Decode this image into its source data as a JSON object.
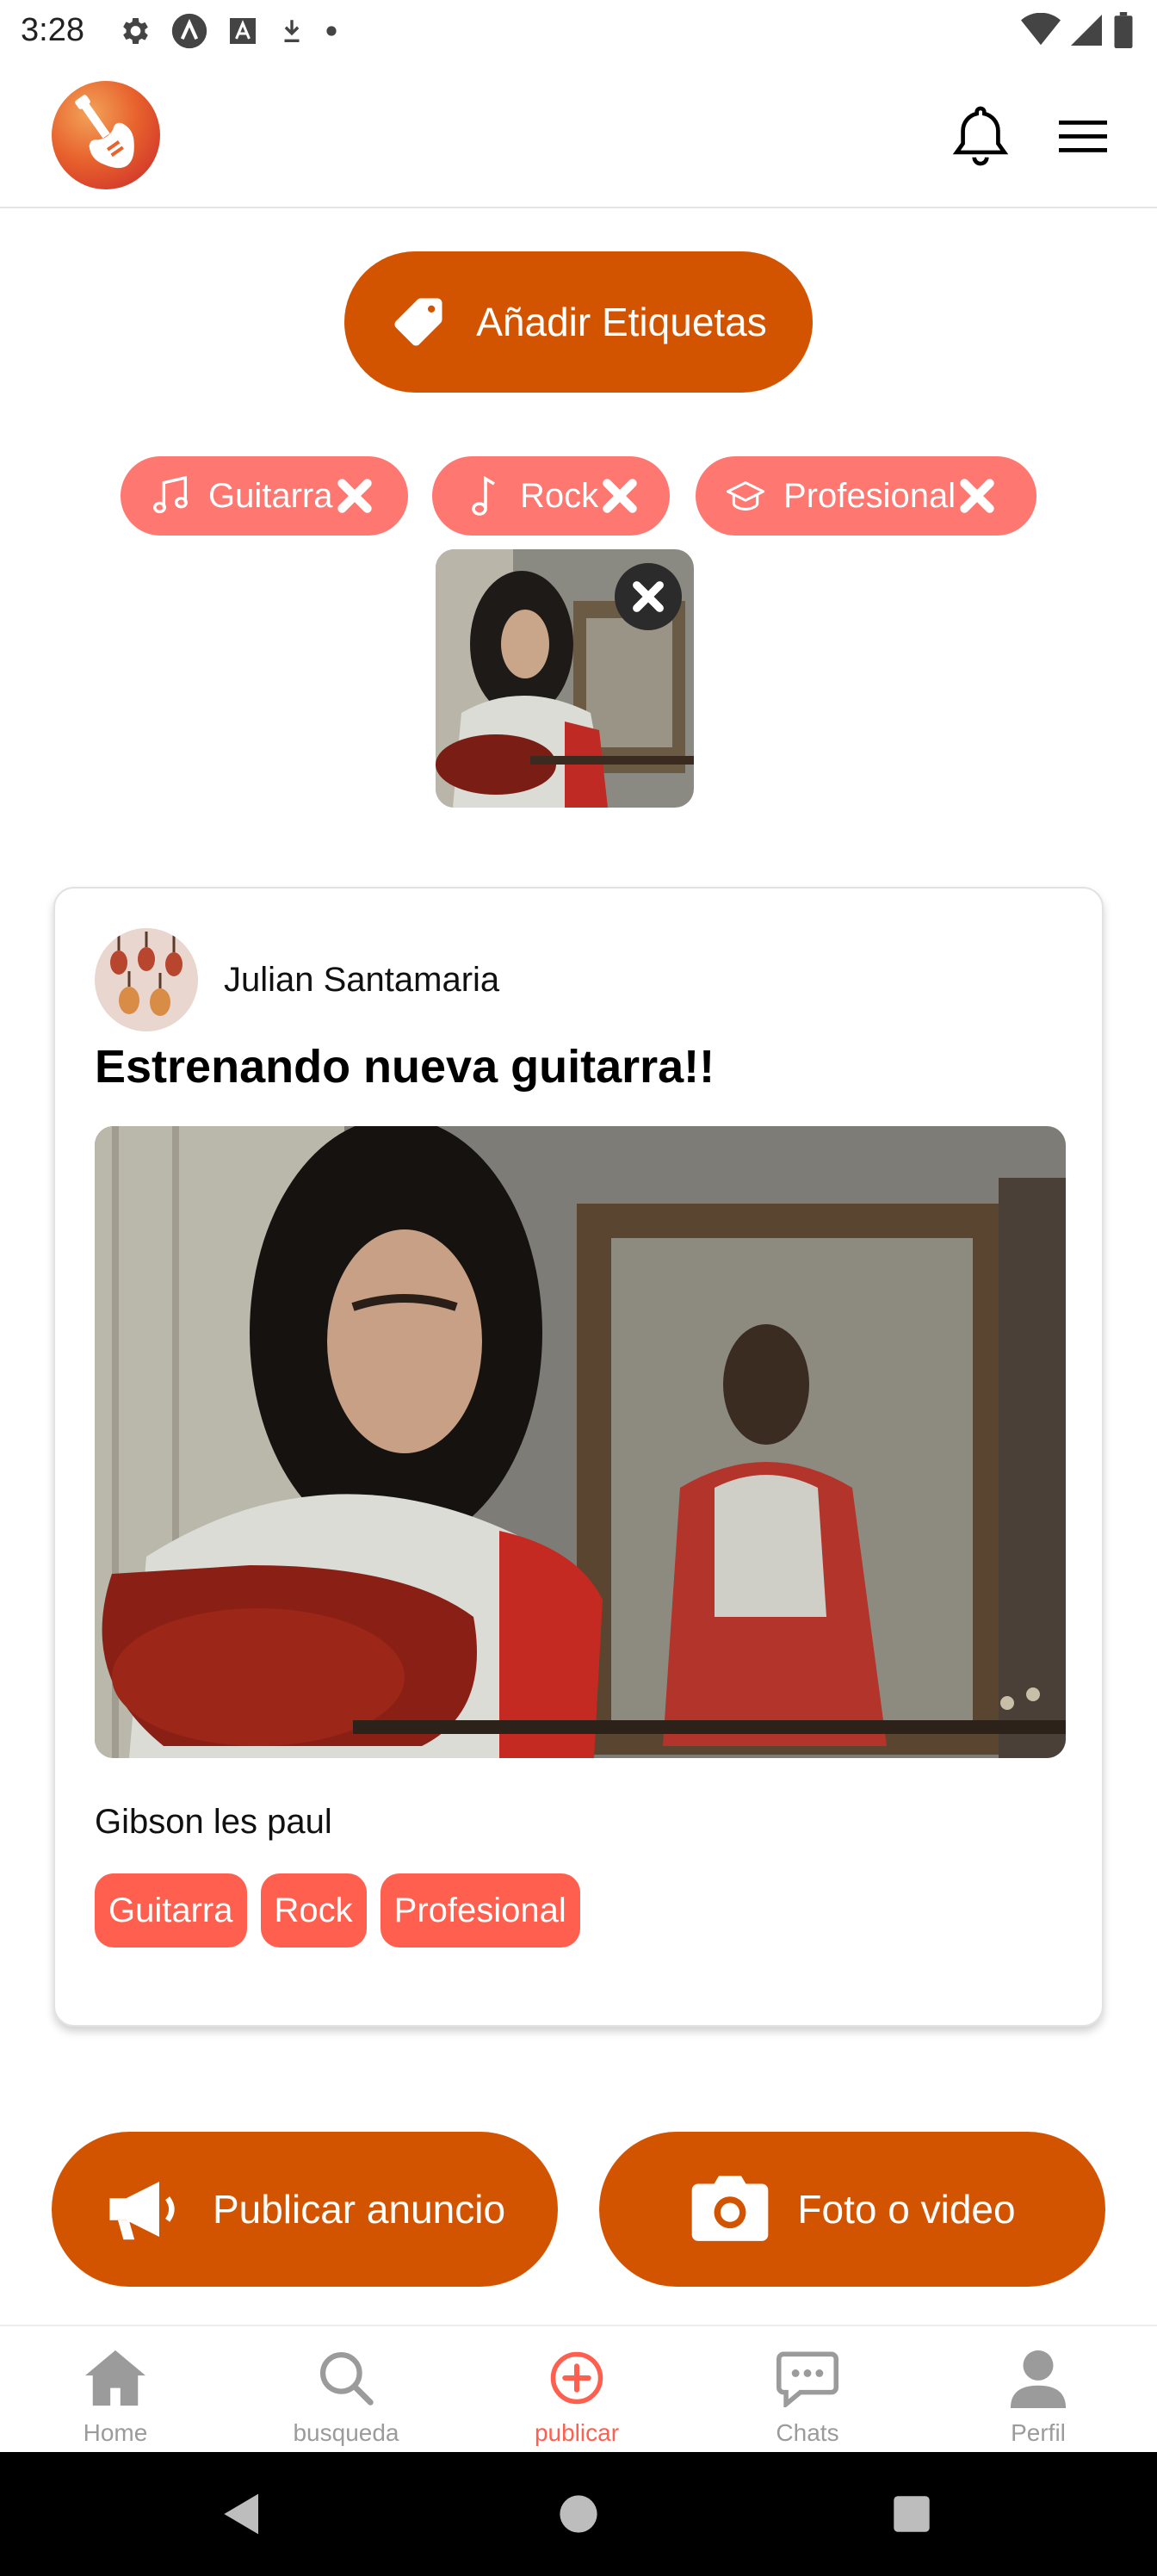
{
  "status_bar": {
    "time": "3:28",
    "left_icons": [
      "gear-icon",
      "a-circle-icon",
      "a-square-icon",
      "download-icon",
      "dot-icon"
    ],
    "right_icons": [
      "wifi-icon",
      "cell-signal-icon",
      "battery-icon"
    ]
  },
  "header": {
    "logo_icon": "guitar-logo-icon",
    "notifications_icon": "bell-icon",
    "menu_icon": "hamburger-menu-icon"
  },
  "add_tags": {
    "label": "Añadir Etiquetas",
    "icon": "tag-icon"
  },
  "selected_tags": [
    {
      "label": "Guitarra",
      "icon": "music-note-icon"
    },
    {
      "label": "Rock",
      "icon": "single-note-icon"
    },
    {
      "label": "Profesional",
      "icon": "graduation-cap-icon"
    }
  ],
  "post": {
    "author": "Julian Santamaria",
    "title": "Estrenando nueva guitarra!!",
    "description": "Gibson les paul",
    "tags": [
      "Guitarra",
      "Rock",
      "Profesional"
    ]
  },
  "actions": {
    "publish_ad": "Publicar anuncio",
    "photo_video": "Foto o video"
  },
  "bottom_nav": [
    {
      "label": "Home",
      "icon": "home-icon",
      "active": false
    },
    {
      "label": "busqueda",
      "icon": "search-icon",
      "active": false
    },
    {
      "label": "publicar",
      "icon": "plus-circle-icon",
      "active": true
    },
    {
      "label": "Chats",
      "icon": "chat-icon",
      "active": false
    },
    {
      "label": "Perfil",
      "icon": "person-icon",
      "active": false
    }
  ],
  "colors": {
    "primary": "#d35400",
    "chip": "#fe7770",
    "tag": "#fe5f4f",
    "active_nav": "#fe5f4f",
    "inactive_nav": "#9b9b9b"
  }
}
